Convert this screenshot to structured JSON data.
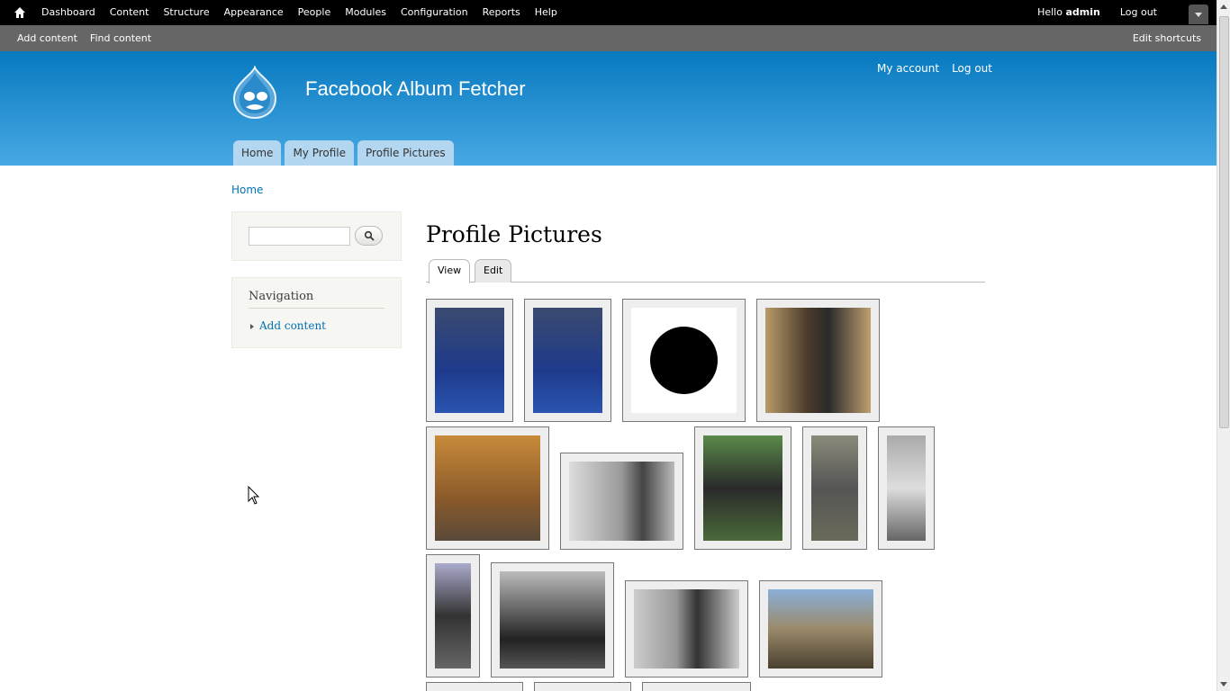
{
  "toolbar": {
    "menu": [
      "Dashboard",
      "Content",
      "Structure",
      "Appearance",
      "People",
      "Modules",
      "Configuration",
      "Reports",
      "Help"
    ],
    "hello_prefix": "Hello",
    "user": "admin",
    "logout": "Log out"
  },
  "shortcuts": {
    "items": [
      "Add content",
      "Find content"
    ],
    "edit": "Edit shortcuts"
  },
  "header": {
    "site_name": "Facebook Album Fetcher",
    "secondary": [
      "My account",
      "Log out"
    ],
    "main_menu": [
      "Home",
      "My Profile",
      "Profile Pictures"
    ]
  },
  "breadcrumb": "Home",
  "sidebar": {
    "navigation_title": "Navigation",
    "navigation_items": [
      "Add content"
    ]
  },
  "main": {
    "title": "Profile Pictures",
    "tabs": [
      "View",
      "Edit"
    ]
  },
  "colors": {
    "header_top": "#0779bf",
    "header_bottom": "#48a9e4",
    "link": "#0071b3"
  },
  "gallery_count": 16
}
